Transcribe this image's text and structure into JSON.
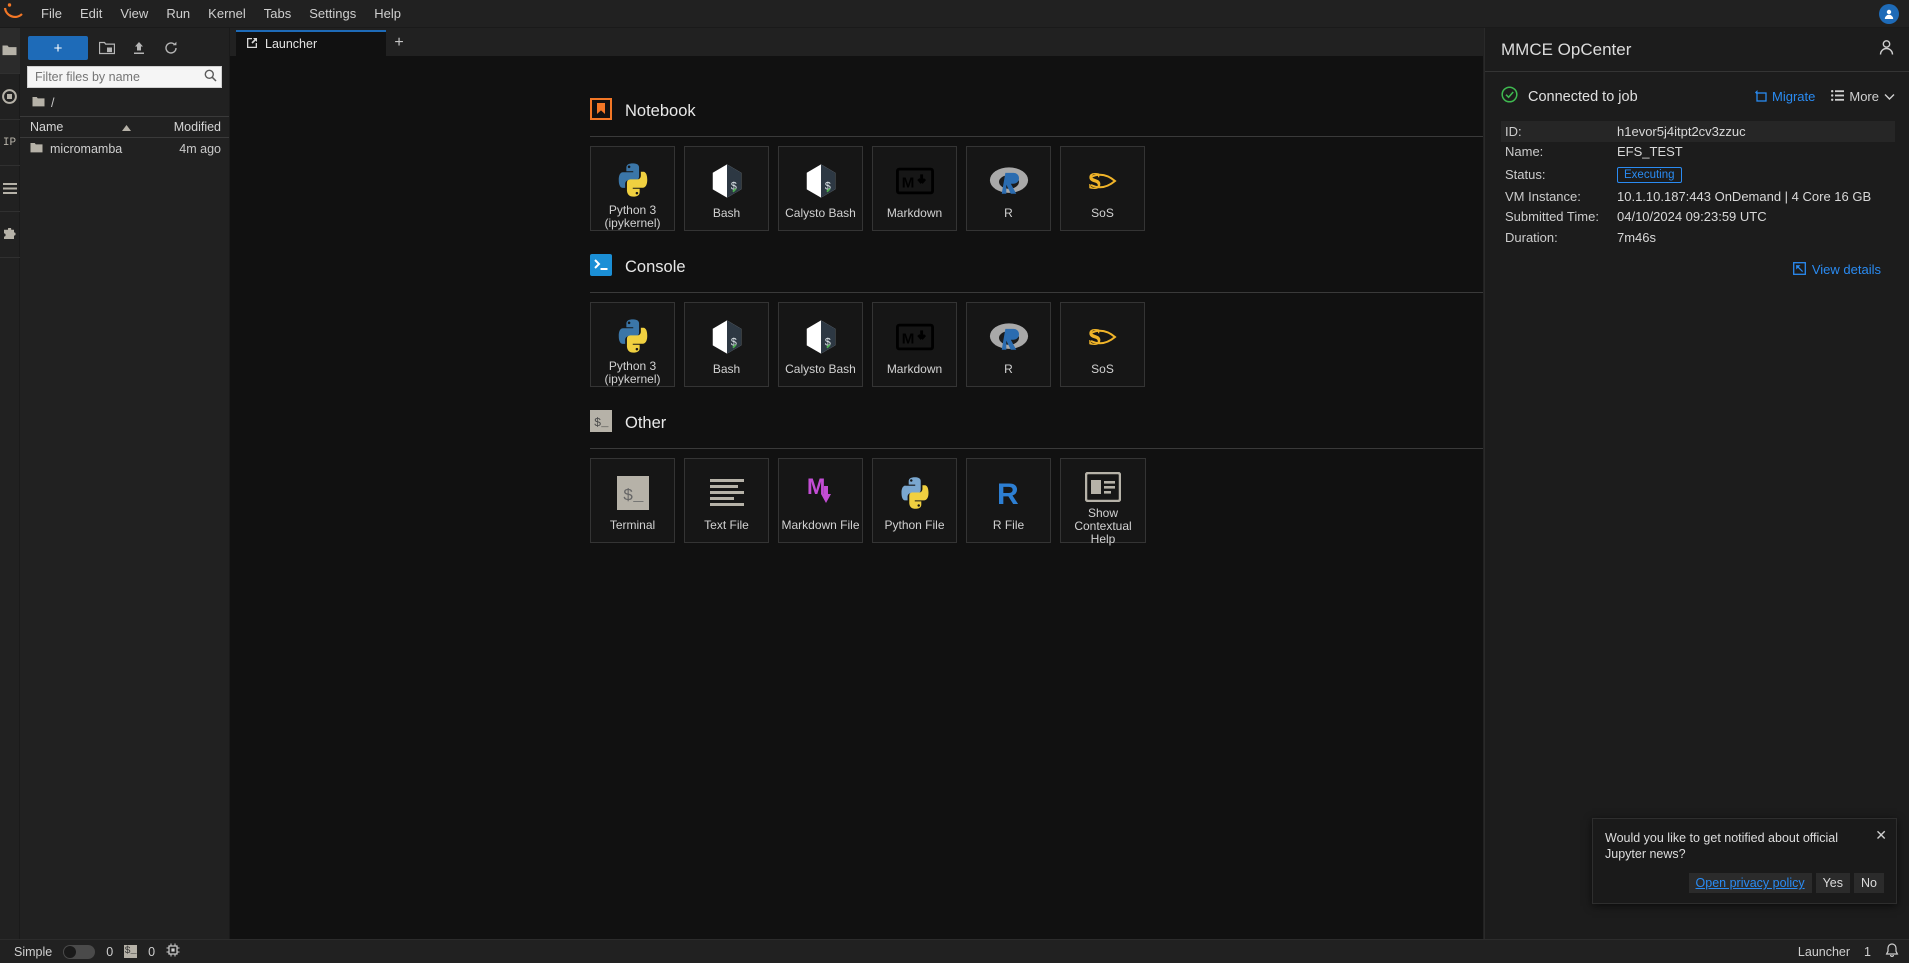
{
  "menu": {
    "logo_icon": "jupyter-logo-icon",
    "items": [
      "File",
      "Edit",
      "View",
      "Run",
      "Kernel",
      "Tabs",
      "Settings",
      "Help"
    ]
  },
  "rail": {
    "items": [
      {
        "name": "file-browser",
        "icon": "folder-icon"
      },
      {
        "name": "running-terminals-kernels",
        "icon": "stop-circle-icon"
      },
      {
        "name": "jupyternaut",
        "icon": "jp-text-icon"
      },
      {
        "name": "command-palette",
        "icon": "list-icon"
      },
      {
        "name": "extension-manager",
        "icon": "puzzle-icon"
      }
    ]
  },
  "filebrowser": {
    "new_label": "+",
    "new_folder_icon": "new-folder-icon",
    "upload_icon": "upload-icon",
    "refresh_icon": "refresh-icon",
    "filter_placeholder": "Filter files by name",
    "filter_value": "",
    "search_icon": "search-icon",
    "breadcrumb_root": "/",
    "columns": {
      "name": "Name",
      "modified": "Modified"
    },
    "sort_icon": "sort-ascending-icon",
    "rows": [
      {
        "name": "micromamba",
        "modified": "4m ago",
        "icon": "folder-icon"
      }
    ]
  },
  "dock": {
    "tab_label": "Launcher",
    "tab_icon": "launcher-icon",
    "add_tab_label": "+"
  },
  "launcher": {
    "sections": [
      {
        "title": "Notebook",
        "icon": "notebook-icon",
        "cards": [
          {
            "label": "Python 3 (ipykernel)",
            "icon": "python-icon"
          },
          {
            "label": "Bash",
            "icon": "bash-kernel-icon"
          },
          {
            "label": "Calysto Bash",
            "icon": "bash-kernel-icon"
          },
          {
            "label": "Markdown",
            "icon": "markdown-icon"
          },
          {
            "label": "R",
            "icon": "r-kernel-icon"
          },
          {
            "label": "SoS",
            "icon": "sos-icon"
          }
        ]
      },
      {
        "title": "Console",
        "icon": "console-icon",
        "cards": [
          {
            "label": "Python 3 (ipykernel)",
            "icon": "python-icon"
          },
          {
            "label": "Bash",
            "icon": "bash-kernel-icon"
          },
          {
            "label": "Calysto Bash",
            "icon": "bash-kernel-icon"
          },
          {
            "label": "Markdown",
            "icon": "markdown-icon"
          },
          {
            "label": "R",
            "icon": "r-kernel-icon"
          },
          {
            "label": "SoS",
            "icon": "sos-icon"
          }
        ]
      },
      {
        "title": "Other",
        "icon": "terminal-icon",
        "cards": [
          {
            "label": "Terminal",
            "icon": "terminal-icon"
          },
          {
            "label": "Text File",
            "icon": "text-file-icon"
          },
          {
            "label": "Markdown File",
            "icon": "markdown-file-icon"
          },
          {
            "label": "Python File",
            "icon": "python-file-icon"
          },
          {
            "label": "R File",
            "icon": "r-file-icon"
          },
          {
            "label": "Show Contextual Help",
            "icon": "contextual-help-icon"
          }
        ]
      }
    ]
  },
  "rightpanel": {
    "title": "MMCE OpCenter",
    "user_icon": "user-icon",
    "status_text": "Connected to job",
    "status_icon": "check-circle-icon",
    "migrate_label": "Migrate",
    "migrate_icon": "migrate-icon",
    "more_label": "More",
    "more_icon": "list-icon",
    "more_chevron": "chevron-down-icon",
    "fields": [
      {
        "key": "ID:",
        "value": "h1evor5j4itpt2cv3zzuc",
        "type": "text"
      },
      {
        "key": "Name:",
        "value": "EFS_TEST",
        "type": "text"
      },
      {
        "key": "Status:",
        "value": "Executing",
        "type": "badge"
      },
      {
        "key": "VM Instance:",
        "value": "10.1.10.187:443 OnDemand | 4 Core 16 GB",
        "type": "text"
      },
      {
        "key": "Submitted Time:",
        "value": "04/10/2024 09:23:59 UTC",
        "type": "text"
      },
      {
        "key": "Duration:",
        "value": "7m46s",
        "type": "text"
      }
    ],
    "view_details_label": "View details",
    "view_details_icon": "external-link-icon"
  },
  "toast": {
    "message": "Would you like to get notified about official Jupyter news?",
    "close_icon": "close-icon",
    "buttons": [
      {
        "label": "Open privacy policy",
        "style": "link"
      },
      {
        "label": "Yes",
        "style": "plain"
      },
      {
        "label": "No",
        "style": "plain"
      }
    ]
  },
  "statusbar": {
    "mode_label": "Simple",
    "kernel_count": "0",
    "terminal_icon": "terminal-chip-icon",
    "terminal_count": "0",
    "cpu_icon": "cpu-icon",
    "active_tab": "Launcher",
    "tab_count": "1",
    "bell_icon": "bell-icon"
  },
  "colors": {
    "accent": "#1e6bb8",
    "link": "#2a8bf2",
    "success": "#3fb950",
    "notebook_orange": "#f37726",
    "panel_bg": "#1c1c1c",
    "app_bg": "#111111"
  }
}
